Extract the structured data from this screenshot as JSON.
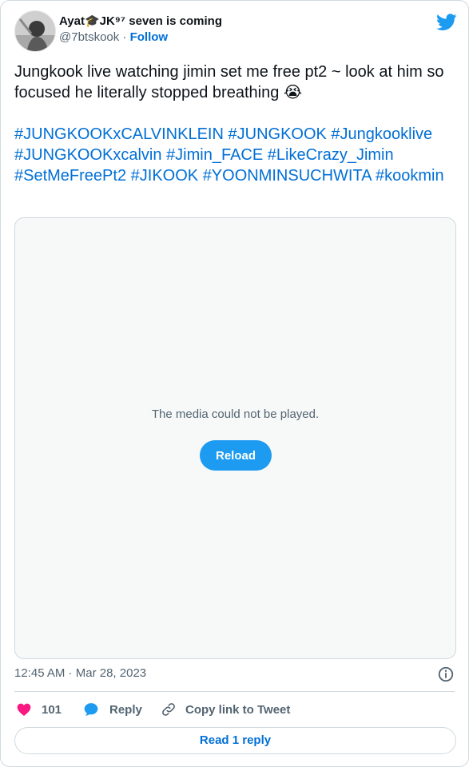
{
  "author": {
    "display_name": "Ayat🎓JK⁹⁷ seven is coming",
    "handle": "@7btskook",
    "separator": " · ",
    "follow_label": "Follow"
  },
  "tweet": {
    "text": "Jungkook live watching jimin set me free pt2 ~ look at him so focused he literally stopped breathing 😭",
    "hashtags": [
      "#JUNGKOOKxCALVINKLEIN",
      "#JUNGKOOK",
      "#Jungkooklive",
      "#JUNGKOOKxcalvin",
      "#Jimin_FACE",
      "#LikeCrazy_Jimin",
      "#SetMeFreePt2",
      "#JIKOOK",
      "#YOONMINSUCHWITA",
      "#kookmin"
    ]
  },
  "media": {
    "message": "The media could not be played.",
    "reload_label": "Reload"
  },
  "meta": {
    "time": "12:45 AM",
    "separator": " · ",
    "date": "Mar 28, 2023"
  },
  "actions": {
    "like_count": "101",
    "reply_label": "Reply",
    "copy_label": "Copy link to Tweet"
  },
  "footer": {
    "read_reply_label": "Read 1 reply"
  },
  "colors": {
    "brand_blue": "#1d9bf0",
    "link_blue": "#006fd6",
    "heart_pink": "#f91880",
    "muted_text": "#536471",
    "border": "#cfd9de"
  },
  "icons": [
    "avatar-image",
    "twitter-bird-icon",
    "info-icon",
    "heart-icon",
    "reply-bubble-icon",
    "link-icon"
  ]
}
